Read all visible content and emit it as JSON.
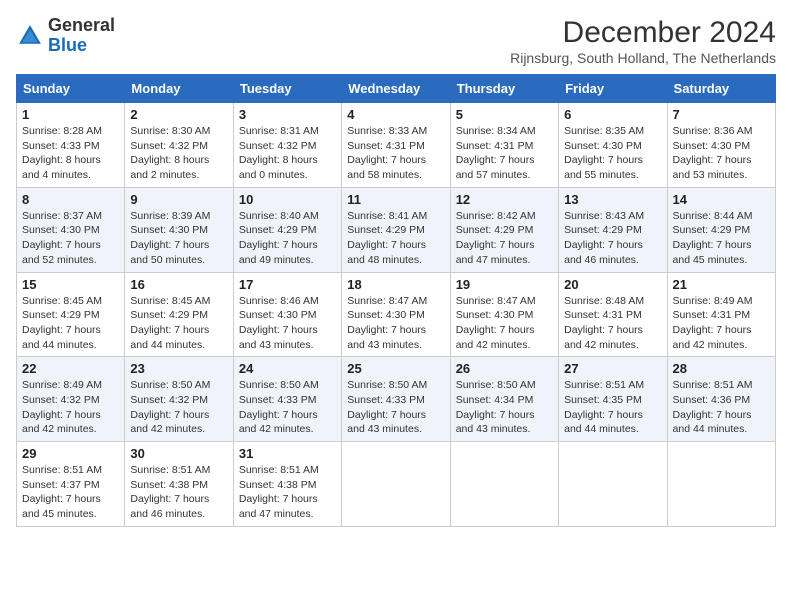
{
  "logo": {
    "line1": "General",
    "line2": "Blue"
  },
  "title": "December 2024",
  "location": "Rijnsburg, South Holland, The Netherlands",
  "weekdays": [
    "Sunday",
    "Monday",
    "Tuesday",
    "Wednesday",
    "Thursday",
    "Friday",
    "Saturday"
  ],
  "weeks": [
    [
      {
        "day": "1",
        "info": "Sunrise: 8:28 AM\nSunset: 4:33 PM\nDaylight: 8 hours\nand 4 minutes."
      },
      {
        "day": "2",
        "info": "Sunrise: 8:30 AM\nSunset: 4:32 PM\nDaylight: 8 hours\nand 2 minutes."
      },
      {
        "day": "3",
        "info": "Sunrise: 8:31 AM\nSunset: 4:32 PM\nDaylight: 8 hours\nand 0 minutes."
      },
      {
        "day": "4",
        "info": "Sunrise: 8:33 AM\nSunset: 4:31 PM\nDaylight: 7 hours\nand 58 minutes."
      },
      {
        "day": "5",
        "info": "Sunrise: 8:34 AM\nSunset: 4:31 PM\nDaylight: 7 hours\nand 57 minutes."
      },
      {
        "day": "6",
        "info": "Sunrise: 8:35 AM\nSunset: 4:30 PM\nDaylight: 7 hours\nand 55 minutes."
      },
      {
        "day": "7",
        "info": "Sunrise: 8:36 AM\nSunset: 4:30 PM\nDaylight: 7 hours\nand 53 minutes."
      }
    ],
    [
      {
        "day": "8",
        "info": "Sunrise: 8:37 AM\nSunset: 4:30 PM\nDaylight: 7 hours\nand 52 minutes."
      },
      {
        "day": "9",
        "info": "Sunrise: 8:39 AM\nSunset: 4:30 PM\nDaylight: 7 hours\nand 50 minutes."
      },
      {
        "day": "10",
        "info": "Sunrise: 8:40 AM\nSunset: 4:29 PM\nDaylight: 7 hours\nand 49 minutes."
      },
      {
        "day": "11",
        "info": "Sunrise: 8:41 AM\nSunset: 4:29 PM\nDaylight: 7 hours\nand 48 minutes."
      },
      {
        "day": "12",
        "info": "Sunrise: 8:42 AM\nSunset: 4:29 PM\nDaylight: 7 hours\nand 47 minutes."
      },
      {
        "day": "13",
        "info": "Sunrise: 8:43 AM\nSunset: 4:29 PM\nDaylight: 7 hours\nand 46 minutes."
      },
      {
        "day": "14",
        "info": "Sunrise: 8:44 AM\nSunset: 4:29 PM\nDaylight: 7 hours\nand 45 minutes."
      }
    ],
    [
      {
        "day": "15",
        "info": "Sunrise: 8:45 AM\nSunset: 4:29 PM\nDaylight: 7 hours\nand 44 minutes."
      },
      {
        "day": "16",
        "info": "Sunrise: 8:45 AM\nSunset: 4:29 PM\nDaylight: 7 hours\nand 44 minutes."
      },
      {
        "day": "17",
        "info": "Sunrise: 8:46 AM\nSunset: 4:30 PM\nDaylight: 7 hours\nand 43 minutes."
      },
      {
        "day": "18",
        "info": "Sunrise: 8:47 AM\nSunset: 4:30 PM\nDaylight: 7 hours\nand 43 minutes."
      },
      {
        "day": "19",
        "info": "Sunrise: 8:47 AM\nSunset: 4:30 PM\nDaylight: 7 hours\nand 42 minutes."
      },
      {
        "day": "20",
        "info": "Sunrise: 8:48 AM\nSunset: 4:31 PM\nDaylight: 7 hours\nand 42 minutes."
      },
      {
        "day": "21",
        "info": "Sunrise: 8:49 AM\nSunset: 4:31 PM\nDaylight: 7 hours\nand 42 minutes."
      }
    ],
    [
      {
        "day": "22",
        "info": "Sunrise: 8:49 AM\nSunset: 4:32 PM\nDaylight: 7 hours\nand 42 minutes."
      },
      {
        "day": "23",
        "info": "Sunrise: 8:50 AM\nSunset: 4:32 PM\nDaylight: 7 hours\nand 42 minutes."
      },
      {
        "day": "24",
        "info": "Sunrise: 8:50 AM\nSunset: 4:33 PM\nDaylight: 7 hours\nand 42 minutes."
      },
      {
        "day": "25",
        "info": "Sunrise: 8:50 AM\nSunset: 4:33 PM\nDaylight: 7 hours\nand 43 minutes."
      },
      {
        "day": "26",
        "info": "Sunrise: 8:50 AM\nSunset: 4:34 PM\nDaylight: 7 hours\nand 43 minutes."
      },
      {
        "day": "27",
        "info": "Sunrise: 8:51 AM\nSunset: 4:35 PM\nDaylight: 7 hours\nand 44 minutes."
      },
      {
        "day": "28",
        "info": "Sunrise: 8:51 AM\nSunset: 4:36 PM\nDaylight: 7 hours\nand 44 minutes."
      }
    ],
    [
      {
        "day": "29",
        "info": "Sunrise: 8:51 AM\nSunset: 4:37 PM\nDaylight: 7 hours\nand 45 minutes."
      },
      {
        "day": "30",
        "info": "Sunrise: 8:51 AM\nSunset: 4:38 PM\nDaylight: 7 hours\nand 46 minutes."
      },
      {
        "day": "31",
        "info": "Sunrise: 8:51 AM\nSunset: 4:38 PM\nDaylight: 7 hours\nand 47 minutes."
      },
      null,
      null,
      null,
      null
    ]
  ],
  "colors": {
    "header_bg": "#2a6bbf",
    "alt_row": "#f0f4fa"
  }
}
